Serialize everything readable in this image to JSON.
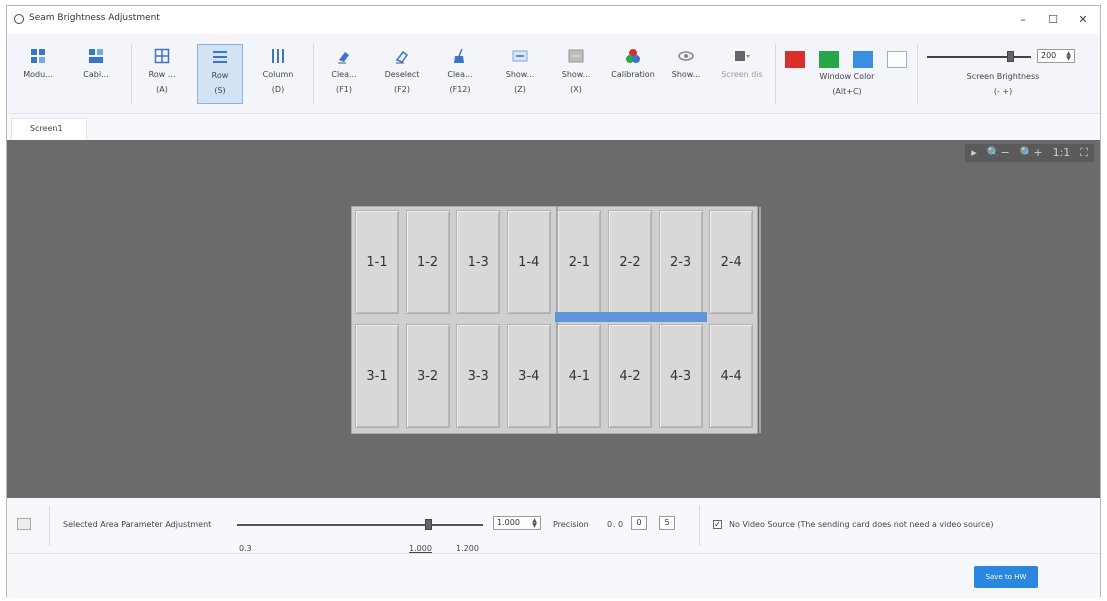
{
  "window": {
    "title": "Seam Brightness Adjustment",
    "minimize": "–",
    "maximize": "☐",
    "close": "✕"
  },
  "toolbar": {
    "module": "Modu...",
    "cabinet": "Cabi...",
    "row_group": {
      "label": "Row ...",
      "key": "(A)"
    },
    "row": {
      "label": "Row",
      "key": "(S)"
    },
    "column": {
      "label": "Column",
      "key": "(D)"
    },
    "clear": {
      "label": "Clea...",
      "key": "(F1)"
    },
    "deselect": {
      "label": "Deselect",
      "key": "(F2)"
    },
    "clear_all": {
      "label": "Clea...",
      "key": "(F12)"
    },
    "show1": {
      "label": "Show...",
      "key": "(Z)"
    },
    "show2": {
      "label": "Show...",
      "key": "(X)"
    },
    "calibration": "Calibration",
    "show3": "Show...",
    "screen_dis": "Screen dis",
    "window_color": {
      "label": "Window Color",
      "key": "(Alt+C)"
    },
    "swatch_colors": [
      "#d9302c",
      "#2aa64a",
      "#3b8ee0",
      "#ffffff"
    ],
    "brightness": {
      "value": "200",
      "label": "Screen Brightness",
      "keys": "(-  +)",
      "level": 0.8
    }
  },
  "tabs": [
    "Screen1"
  ],
  "canvas": {
    "zoom_controls": {
      "collapse": "▸",
      "zoom_out": "🔍−",
      "zoom_in": "🔍+",
      "actual": "1:1",
      "fit": "⛶"
    },
    "cells": [
      [
        "1-1",
        "1-2",
        "1-3",
        "1-4",
        "2-1",
        "2-2",
        "2-3",
        "2-4"
      ],
      [
        "3-1",
        "3-2",
        "3-3",
        "3-4",
        "4-1",
        "4-2",
        "4-3",
        "4-4"
      ]
    ]
  },
  "bottom": {
    "label": "Selected Area Parameter Adjustment",
    "min": "0.3",
    "mid": "1.000",
    "max": "1.200",
    "value": "1.000",
    "slider_value": 1.0,
    "precision_label": "Precision",
    "precision_values": [
      "0",
      "0",
      "0",
      "5"
    ],
    "checkbox_label": "No Video Source (The sending card does not need a video source)",
    "checked": "✓",
    "save": "Save to HW"
  }
}
